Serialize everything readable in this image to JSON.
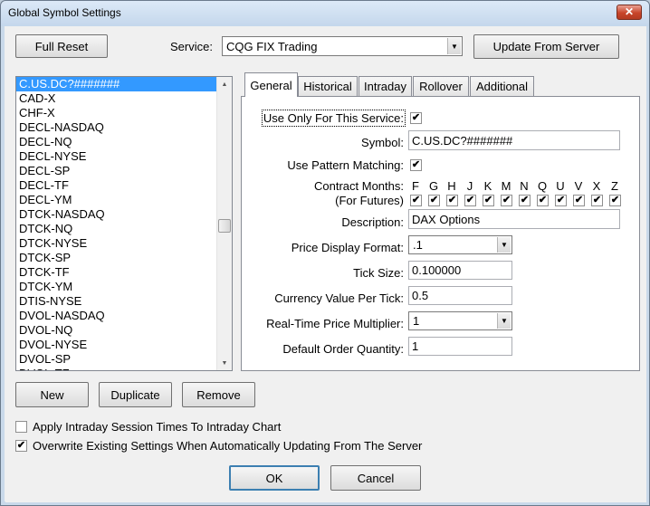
{
  "window": {
    "title": "Global Symbol Settings",
    "close_glyph": "✕"
  },
  "top": {
    "full_reset": "Full Reset",
    "service_label": "Service:",
    "service_value": "CQG FIX Trading",
    "update_button": "Update From Server"
  },
  "symbol_list": [
    "C.US.DC?#######",
    "CAD-X",
    "CHF-X",
    "DECL-NASDAQ",
    "DECL-NQ",
    "DECL-NYSE",
    "DECL-SP",
    "DECL-TF",
    "DECL-YM",
    "DTCK-NASDAQ",
    "DTCK-NQ",
    "DTCK-NYSE",
    "DTCK-SP",
    "DTCK-TF",
    "DTCK-YM",
    "DTIS-NYSE",
    "DVOL-NASDAQ",
    "DVOL-NQ",
    "DVOL-NYSE",
    "DVOL-SP",
    "DVOL-TF"
  ],
  "tabs": [
    "General",
    "Historical",
    "Intraday",
    "Rollover",
    "Additional"
  ],
  "general": {
    "use_only_label": "Use Only For This Service:",
    "use_only_checked": true,
    "symbol_label": "Symbol:",
    "symbol_value": "C.US.DC?#######",
    "pattern_label": "Use Pattern Matching:",
    "pattern_checked": true,
    "contract_months_label": "Contract Months:",
    "for_futures_label": "(For Futures)",
    "months": [
      "F",
      "G",
      "H",
      "J",
      "K",
      "M",
      "N",
      "Q",
      "U",
      "V",
      "X",
      "Z"
    ],
    "description_label": "Description:",
    "description_value": "DAX Options",
    "price_format_label": "Price Display Format:",
    "price_format_value": ".1",
    "tick_size_label": "Tick Size:",
    "tick_size_value": "0.100000",
    "currency_label": "Currency Value Per Tick:",
    "currency_value": "0.5",
    "multiplier_label": "Real-Time Price Multiplier:",
    "multiplier_value": "1",
    "order_qty_label": "Default Order Quantity:",
    "order_qty_value": "1"
  },
  "list_buttons": {
    "new": "New",
    "duplicate": "Duplicate",
    "remove": "Remove"
  },
  "options": {
    "apply_intraday": "Apply Intraday Session Times To Intraday Chart",
    "apply_intraday_checked": false,
    "overwrite": "Overwrite Existing Settings When Automatically Updating From The Server",
    "overwrite_checked": true
  },
  "footer": {
    "ok": "OK",
    "cancel": "Cancel"
  },
  "icons": {
    "check": "✔",
    "dropdown": "▼",
    "scroll_up": "▲",
    "scroll_down": "▼"
  }
}
